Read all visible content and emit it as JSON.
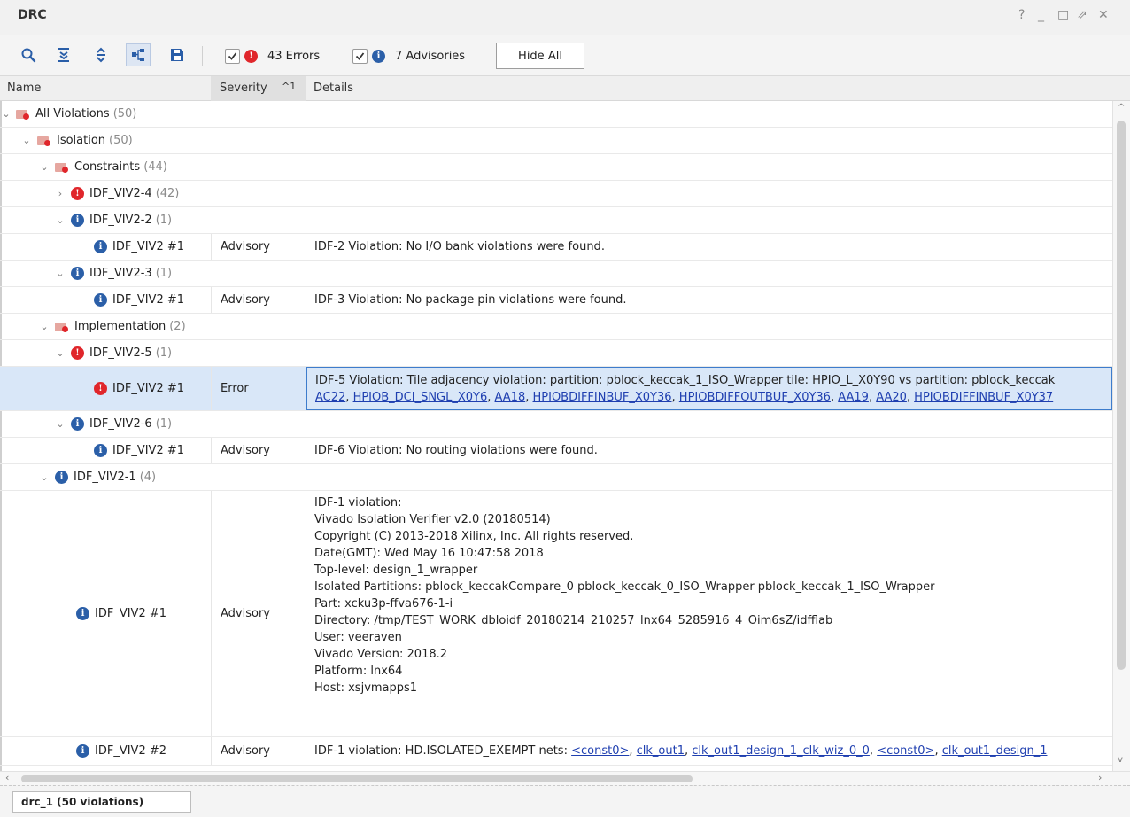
{
  "window": {
    "title": "DRC",
    "controls": [
      "?",
      "_",
      "□",
      "⇗",
      "✕"
    ]
  },
  "toolbar": {
    "icons": [
      "search-icon",
      "collapse-all-icon",
      "expand-all-icon",
      "group-by-icon",
      "save-icon"
    ],
    "errors_filter": {
      "checked": true,
      "label": "43 Errors"
    },
    "advisories_filter": {
      "checked": true,
      "label": "7 Advisories"
    },
    "hide_all_label": "Hide All"
  },
  "columns": {
    "name": "Name",
    "severity": "Severity",
    "sort_indicator": "^1",
    "details": "Details"
  },
  "tree": {
    "all_violations": {
      "label": "All Violations",
      "count": "(50)"
    },
    "isolation": {
      "label": "Isolation",
      "count": "(50)"
    },
    "constraints": {
      "label": "Constraints",
      "count": "(44)"
    },
    "viv2_4": {
      "label": "IDF_VIV2-4",
      "count": "(42)"
    },
    "viv2_2": {
      "label": "IDF_VIV2-2",
      "count": "(1)"
    },
    "viv2_2_item": {
      "name": "IDF_VIV2 #1",
      "severity": "Advisory",
      "details": "IDF-2 Violation: No I/O bank violations were found."
    },
    "viv2_3": {
      "label": "IDF_VIV2-3",
      "count": "(1)"
    },
    "viv2_3_item": {
      "name": "IDF_VIV2 #1",
      "severity": "Advisory",
      "details": "IDF-3 Violation: No package pin violations were found."
    },
    "implementation": {
      "label": "Implementation",
      "count": "(2)"
    },
    "viv2_5": {
      "label": "IDF_VIV2-5",
      "count": "(1)"
    },
    "viv2_5_item": {
      "name": "IDF_VIV2 #1",
      "severity": "Error",
      "details_line1": "IDF-5 Violation: Tile adjacency violation: partition: pblock_keccak_1_ISO_Wrapper tile: HPIO_L_X0Y90 vs partition: pblock_keccak",
      "links": [
        "AC22",
        "HPIOB_DCI_SNGL_X0Y6",
        "AA18",
        "HPIOBDIFFINBUF_X0Y36",
        "HPIOBDIFFOUTBUF_X0Y36",
        "AA19",
        "AA20",
        "HPIOBDIFFINBUF_X0Y37"
      ]
    },
    "viv2_6": {
      "label": "IDF_VIV2-6",
      "count": "(1)"
    },
    "viv2_6_item": {
      "name": "IDF_VIV2 #1",
      "severity": "Advisory",
      "details": "IDF-6 Violation: No routing violations were found."
    },
    "viv2_1": {
      "label": "IDF_VIV2-1",
      "count": "(4)"
    },
    "viv2_1_item1": {
      "name": "IDF_VIV2 #1",
      "severity": "Advisory",
      "lines": [
        "IDF-1 violation:",
        "Vivado Isolation Verifier v2.0 (20180514)",
        "Copyright (C) 2013-2018 Xilinx, Inc. All rights reserved.",
        "Date(GMT): Wed May 16 10:47:58 2018",
        "Top-level: design_1_wrapper",
        "Isolated Partitions: pblock_keccakCompare_0 pblock_keccak_0_ISO_Wrapper pblock_keccak_1_ISO_Wrapper",
        "Part: xcku3p-ffva676-1-i",
        "Directory: /tmp/TEST_WORK_dbloidf_20180214_210257_lnx64_5285916_4_Oim6sZ/idfflab",
        "User: veeraven",
        "Vivado Version: 2018.2",
        "Platform: lnx64",
        "Host: xsjvmapps1"
      ]
    },
    "viv2_1_item2": {
      "name": "IDF_VIV2 #2",
      "severity": "Advisory",
      "prefix": "IDF-1 violation: HD.ISOLATED_EXEMPT nets:",
      "links": [
        "<const0>",
        "clk_out1",
        "clk_out1_design_1_clk_wiz_0_0",
        "<const0>",
        "clk_out1_design_1"
      ]
    }
  },
  "status": {
    "tab_label": "drc_1 (50 violations)"
  }
}
